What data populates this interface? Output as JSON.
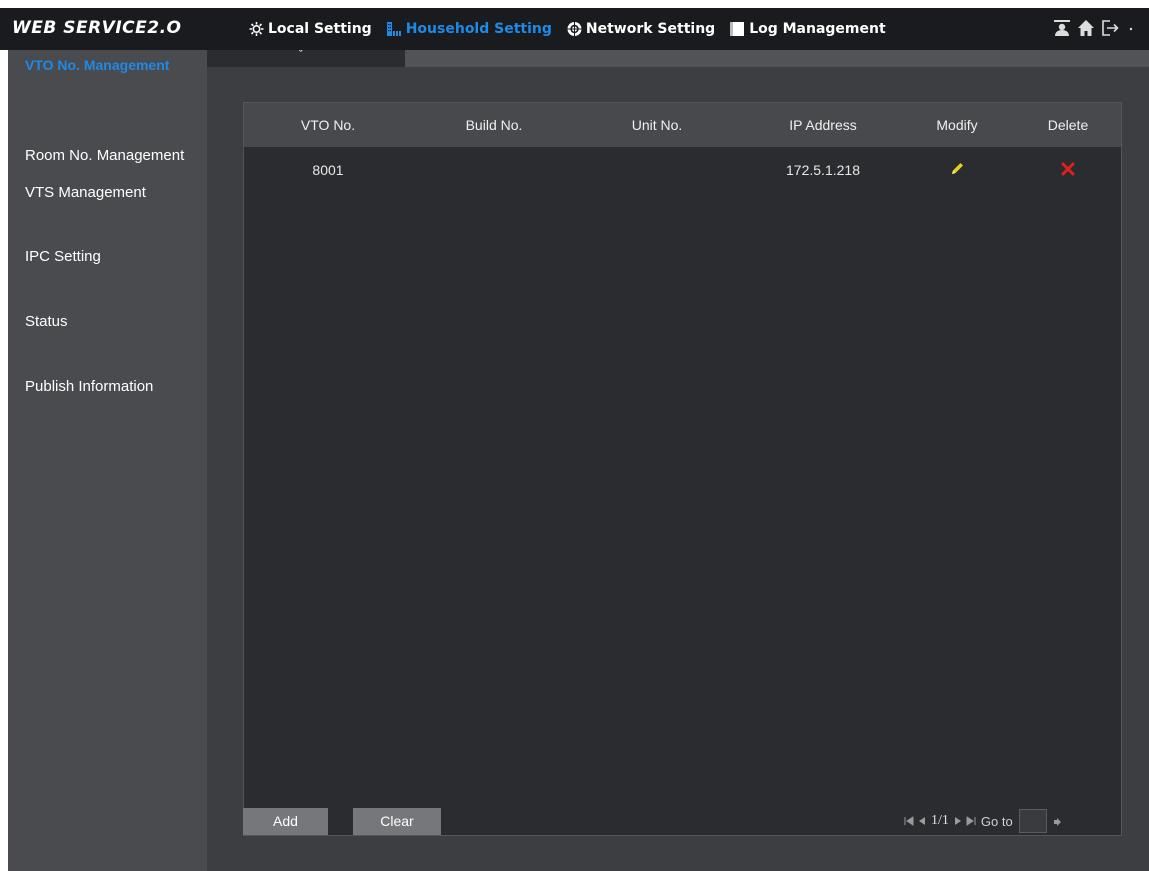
{
  "app": {
    "logo": "WEB SERVICE2.O"
  },
  "nav": {
    "items": [
      {
        "label": "Local Setting",
        "icon": "gear-icon",
        "active": false
      },
      {
        "label": "Household Setting",
        "icon": "building-icon",
        "active": true
      },
      {
        "label": "Network Setting",
        "icon": "network-globe-icon",
        "active": false
      },
      {
        "label": "Log Management",
        "icon": "log-icon",
        "active": false
      }
    ],
    "right_icons": [
      "user-icon",
      "home-icon",
      "logout-icon",
      "chevron-down-icon"
    ]
  },
  "sidebar": {
    "items": [
      {
        "label": "VTO No. Management",
        "active": true
      },
      {
        "label": "Room No. Management",
        "active": false
      },
      {
        "label": "VTS Management",
        "active": false
      },
      {
        "label": "IPC Setting",
        "active": false
      },
      {
        "label": "Status",
        "active": false
      },
      {
        "label": "Publish Information",
        "active": false
      }
    ]
  },
  "tab": {
    "label": "ˇ"
  },
  "table": {
    "columns": [
      "VTO No.",
      "Build No.",
      "Unit No.",
      "IP Address",
      "Modify",
      "Delete"
    ],
    "rows": [
      {
        "vto_no": "8001",
        "build_no": "",
        "unit_no": "",
        "ip_address": "172.5.1.218",
        "modify_icon": "pencil-icon",
        "delete_icon": "delete-x-icon"
      }
    ]
  },
  "buttons": {
    "add": "Add",
    "clear": "Clear"
  },
  "pager": {
    "page": "1/1",
    "goto_label": "Go to",
    "goto_value": ""
  },
  "colors": {
    "accent": "#1e8ae6",
    "header_bg": "#1a1b1e",
    "sidebar_bg": "#4a4b4f",
    "panel_bg": "#2b2c30",
    "delete": "#e02020",
    "modify": "#e8d21c"
  }
}
